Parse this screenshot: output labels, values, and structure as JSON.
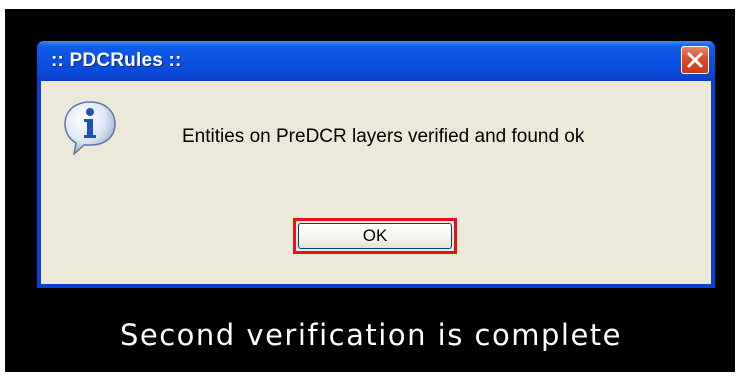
{
  "dialog": {
    "title": ":: PDCRules ::",
    "message": "Entities on PreDCR layers verified and found ok",
    "ok_label": "OK",
    "icon": "information-icon",
    "close_icon": "close-icon"
  },
  "caption": {
    "text": "Second verification is complete"
  },
  "colors": {
    "titlebar": "#0a4fe0",
    "client_background": "#ece9d8",
    "close_button": "#db4b25",
    "highlight_border": "#e3131a",
    "frame": "#000000"
  }
}
